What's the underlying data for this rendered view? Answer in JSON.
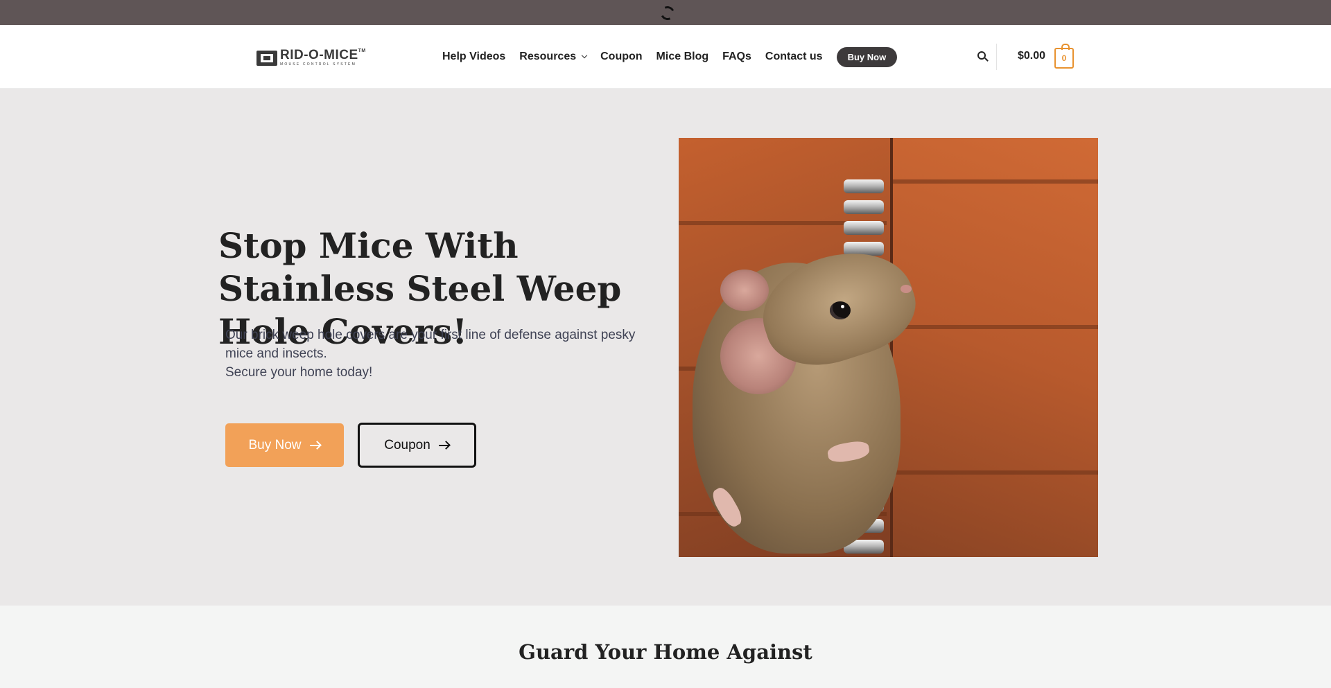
{
  "topbar": {
    "loading_icon": "spinner-icon"
  },
  "header": {
    "logo": {
      "text": "RID-O-MICE",
      "tm": "TM",
      "tagline": "MOUSE CONTROL SYSTEM"
    },
    "nav": [
      {
        "label": "Help Videos"
      },
      {
        "label": "Resources",
        "has_dropdown": true
      },
      {
        "label": "Coupon"
      },
      {
        "label": "Mice Blog"
      },
      {
        "label": "FAQs"
      },
      {
        "label": "Contact us"
      }
    ],
    "nav_buy_label": "Buy Now",
    "cart_total": "$0.00",
    "cart_count": "0",
    "accent_color": "#e8922f"
  },
  "hero": {
    "title": "Stop Mice With Stainless Steel Weep Hole Covers!",
    "description_line1": "Our brick weep hole covers are your first line of defense against pesky mice and insects.",
    "description_line2": "Secure your home today!",
    "buy_label": "Buy Now",
    "coupon_label": "Coupon",
    "buy_color": "#f2a158",
    "image_subject": "mouse beside stainless steel coil weep hole cover in orange brick wall"
  },
  "section2": {
    "title": "Guard Your Home Against"
  }
}
